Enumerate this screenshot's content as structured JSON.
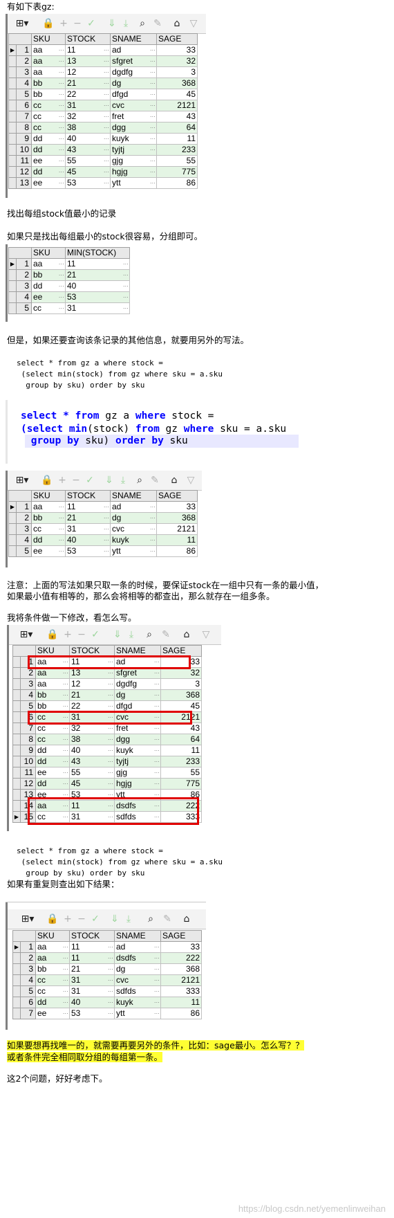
{
  "text": {
    "p1": "有如下表gz:",
    "p2": "找出每组stock值最小的记录",
    "p3": "如果只是找出每组最小的stock很容易，分组即可。",
    "p4": "但是，如果还要查询该条记录的其他信息，就要用另外的写法。",
    "p5a": "注意：上面的写法如果只取一条的时候，要保证stock在一组中只有一条的最小值，",
    "p5b": "如果最小值有相等的，那么会将相等的都查出，那么就存在一组多条。",
    "p6": "我将条件做一下修改，看怎么写。",
    "p7": "如果有重复则查出如下结果：",
    "p8a": "如果要想再找唯一的，就需要再要另外的条件，比如：sage最小。怎么写？？",
    "p8b": "或者条件完全相同取分组的每组第一条。",
    "p9": "这2个问题，好好考虑下。",
    "watermark": "https://blog.csdn.net/yemenlinweihan"
  },
  "code1": [
    "select * from gz a where stock =",
    " (select min(stock) from gz where sku = a.sku",
    "  group by sku) order by sku"
  ],
  "code2": [
    [
      {
        "t": "select",
        "k": 1
      },
      {
        "t": " "
      },
      {
        "t": "*",
        "k": 1
      },
      {
        "t": " "
      },
      {
        "t": "from",
        "k": 1
      },
      {
        "t": " gz a "
      },
      {
        "t": "where",
        "k": 1
      },
      {
        "t": " stock ="
      }
    ],
    [
      {
        "t": "(",
        "k": 1
      },
      {
        "t": "select",
        "k": 1
      },
      {
        "t": " "
      },
      {
        "t": "min",
        "k": 1
      },
      {
        "t": "(stock) "
      },
      {
        "t": "from",
        "k": 1
      },
      {
        "t": " gz "
      },
      {
        "t": "where",
        "k": 1
      },
      {
        "t": " sku = a.sku"
      }
    ],
    [
      {
        "t": " "
      },
      {
        "t": "group by",
        "k": 1
      },
      {
        "t": " sku) "
      },
      {
        "t": "order by",
        "k": 1
      },
      {
        "t": " sku"
      }
    ]
  ],
  "code3": [
    "select * from gz a where stock =",
    " (select min(stock) from gz where sku = a.sku",
    "  group by sku) order by sku"
  ],
  "tables": {
    "t1": {
      "headers": [
        "SKU",
        "STOCK",
        "SNAME",
        "SAGE"
      ],
      "rows": [
        [
          "1",
          "aa",
          "11",
          "ad",
          "33"
        ],
        [
          "2",
          "aa",
          "13",
          "sfgret",
          "32"
        ],
        [
          "3",
          "aa",
          "12",
          "dgdfg",
          "3"
        ],
        [
          "4",
          "bb",
          "21",
          "dg",
          "368"
        ],
        [
          "5",
          "bb",
          "22",
          "dfgd",
          "45"
        ],
        [
          "6",
          "cc",
          "31",
          "cvc",
          "2121"
        ],
        [
          "7",
          "cc",
          "32",
          "fret",
          "43"
        ],
        [
          "8",
          "cc",
          "38",
          "dgg",
          "64"
        ],
        [
          "9",
          "dd",
          "40",
          "kuyk",
          "11"
        ],
        [
          "10",
          "dd",
          "43",
          "tyjtj",
          "233"
        ],
        [
          "11",
          "ee",
          "55",
          "gjg",
          "55"
        ],
        [
          "12",
          "dd",
          "45",
          "hgjg",
          "775"
        ],
        [
          "13",
          "ee",
          "53",
          "ytt",
          "86"
        ]
      ]
    },
    "t2": {
      "headers": [
        "SKU",
        "MIN(STOCK)"
      ],
      "rows": [
        [
          "1",
          "aa",
          "11"
        ],
        [
          "2",
          "bb",
          "21"
        ],
        [
          "3",
          "dd",
          "40"
        ],
        [
          "4",
          "ee",
          "53"
        ],
        [
          "5",
          "cc",
          "31"
        ]
      ]
    },
    "t3": {
      "headers": [
        "SKU",
        "STOCK",
        "SNAME",
        "SAGE"
      ],
      "rows": [
        [
          "1",
          "aa",
          "11",
          "ad",
          "33"
        ],
        [
          "2",
          "bb",
          "21",
          "dg",
          "368"
        ],
        [
          "3",
          "cc",
          "31",
          "cvc",
          "2121"
        ],
        [
          "4",
          "dd",
          "40",
          "kuyk",
          "11"
        ],
        [
          "5",
          "ee",
          "53",
          "ytt",
          "86"
        ]
      ]
    },
    "t4": {
      "headers": [
        "SKU",
        "STOCK",
        "SNAME",
        "SAGE"
      ],
      "rows": [
        [
          "1",
          "aa",
          "11",
          "ad",
          "33"
        ],
        [
          "2",
          "aa",
          "13",
          "sfgret",
          "32"
        ],
        [
          "3",
          "aa",
          "12",
          "dgdfg",
          "3"
        ],
        [
          "4",
          "bb",
          "21",
          "dg",
          "368"
        ],
        [
          "5",
          "bb",
          "22",
          "dfgd",
          "45"
        ],
        [
          "6",
          "cc",
          "31",
          "cvc",
          "2121"
        ],
        [
          "7",
          "cc",
          "32",
          "fret",
          "43"
        ],
        [
          "8",
          "cc",
          "38",
          "dgg",
          "64"
        ],
        [
          "9",
          "dd",
          "40",
          "kuyk",
          "11"
        ],
        [
          "10",
          "dd",
          "43",
          "tyjtj",
          "233"
        ],
        [
          "11",
          "ee",
          "55",
          "gjg",
          "55"
        ],
        [
          "12",
          "dd",
          "45",
          "hgjg",
          "775"
        ],
        [
          "13",
          "ee",
          "53",
          "ytt",
          "86"
        ],
        [
          "14",
          "aa",
          "11",
          "dsdfs",
          "222"
        ],
        [
          "15",
          "cc",
          "31",
          "sdfds",
          "333"
        ]
      ]
    },
    "t5": {
      "headers": [
        "SKU",
        "STOCK",
        "SNAME",
        "SAGE"
      ],
      "rows": [
        [
          "1",
          "aa",
          "11",
          "ad",
          "33"
        ],
        [
          "2",
          "aa",
          "11",
          "dsdfs",
          "222"
        ],
        [
          "3",
          "bb",
          "21",
          "dg",
          "368"
        ],
        [
          "4",
          "cc",
          "31",
          "cvc",
          "2121"
        ],
        [
          "5",
          "cc",
          "31",
          "sdfds",
          "333"
        ],
        [
          "6",
          "dd",
          "40",
          "kuyk",
          "11"
        ],
        [
          "7",
          "ee",
          "53",
          "ytt",
          "86"
        ]
      ]
    }
  },
  "colors": {
    "highlight": "#ffff33",
    "redbox": "#e00000",
    "altrow": "#e4f5e4",
    "keyword": "#0000ff"
  }
}
